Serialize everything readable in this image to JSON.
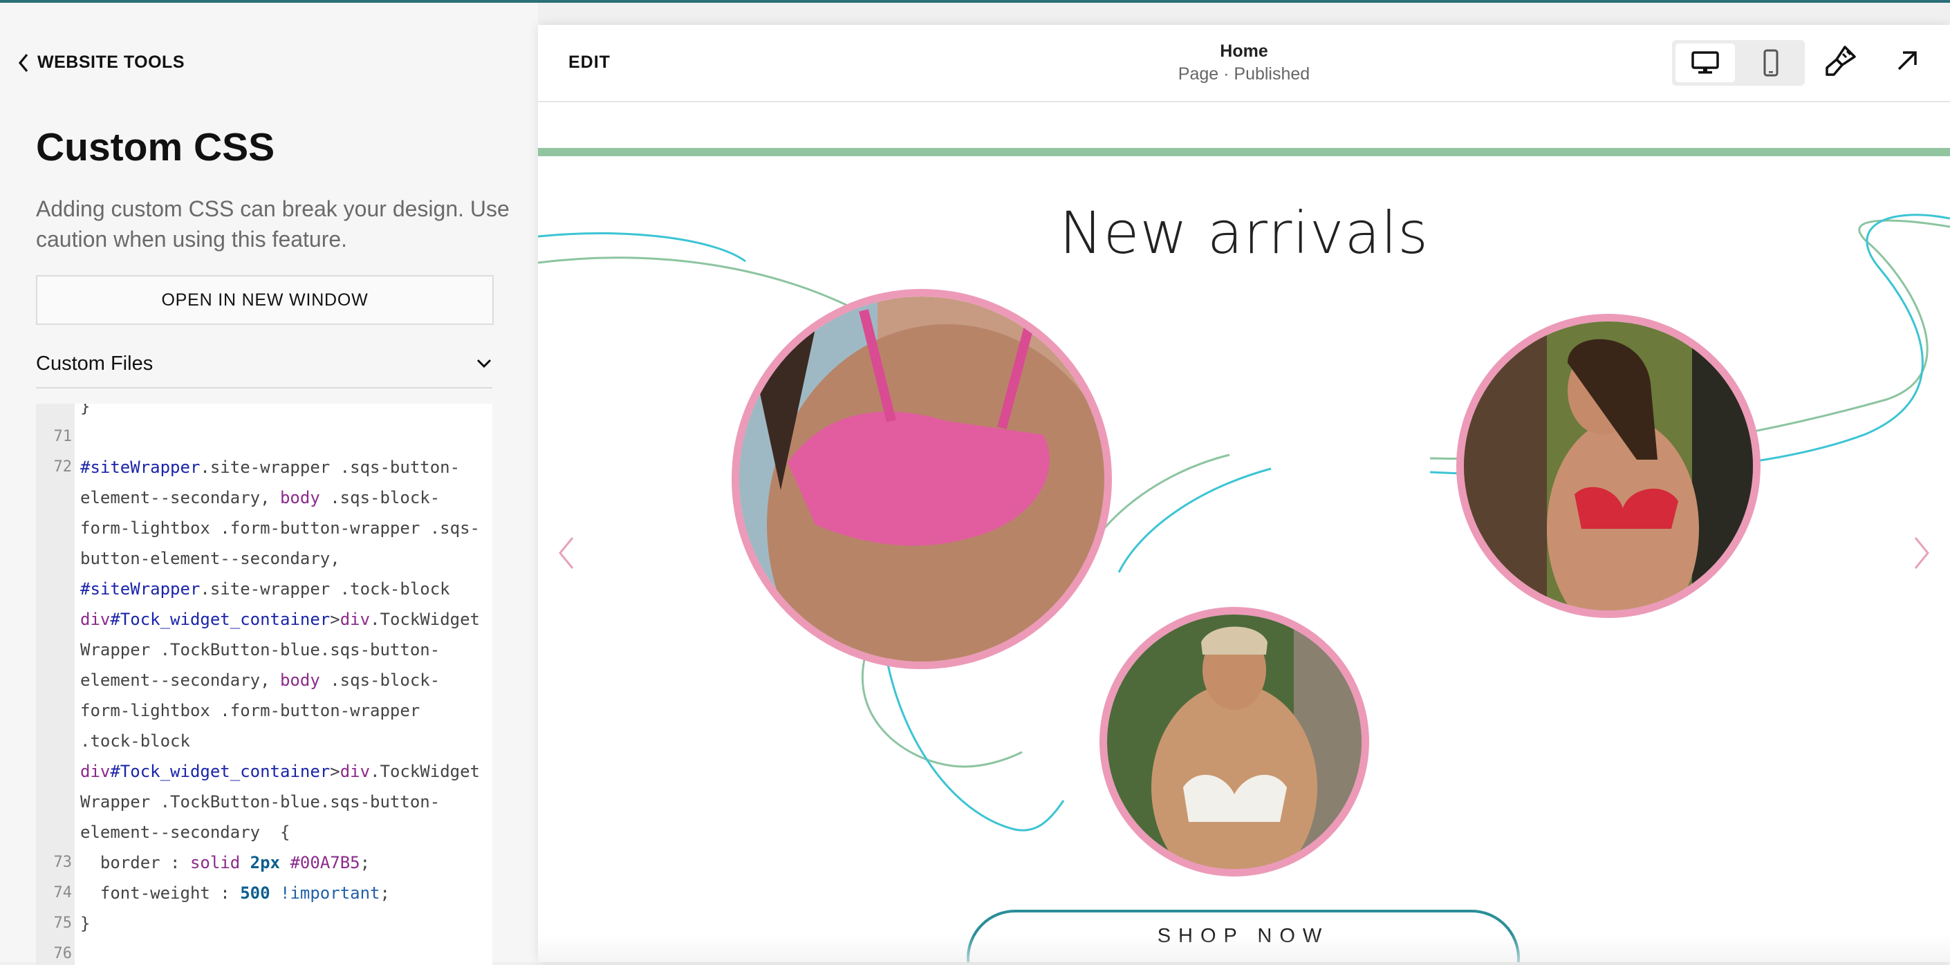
{
  "panel": {
    "back_label": "WEBSITE TOOLS",
    "title": "Custom CSS",
    "description": "Adding custom CSS can break your design. Use caution when using this feature.",
    "open_button": "OPEN IN NEW WINDOW",
    "custom_files_label": "Custom Files"
  },
  "editor": {
    "line_numbers": [
      "71",
      "72",
      "73",
      "74",
      "75",
      "76"
    ],
    "code_lines": [
      "}",
      "",
      "#siteWrapper.site-wrapper .sqs-button-",
      "element--secondary, body .sqs-block-",
      "form-lightbox .form-button-wrapper .sqs-",
      "button-element--secondary,",
      "#siteWrapper.site-wrapper .tock-block",
      "div#Tock_widget_container>div.TockWidget",
      "Wrapper .TockButton-blue.sqs-button-",
      "element--secondary, body .sqs-block-",
      "form-lightbox .form-button-wrapper",
      ".tock-block",
      "div#Tock_widget_container>div.TockWidget",
      "Wrapper .TockButton-blue.sqs-button-",
      "element--secondary  {",
      "  border : solid 2px #00A7B5;",
      "  font-weight : 500 !important;",
      "}",
      ""
    ]
  },
  "toolbar": {
    "edit_label": "EDIT",
    "page_title": "Home",
    "page_status": "Page · Published"
  },
  "site": {
    "heading": "New arrivals",
    "shop_button": "SHOP NOW",
    "accent_colors": {
      "pink_frame": "#ec9ab8",
      "teal_line": "#3cc4d4",
      "green_line": "#8cc4a0",
      "button_border": "#2b8e98"
    }
  }
}
